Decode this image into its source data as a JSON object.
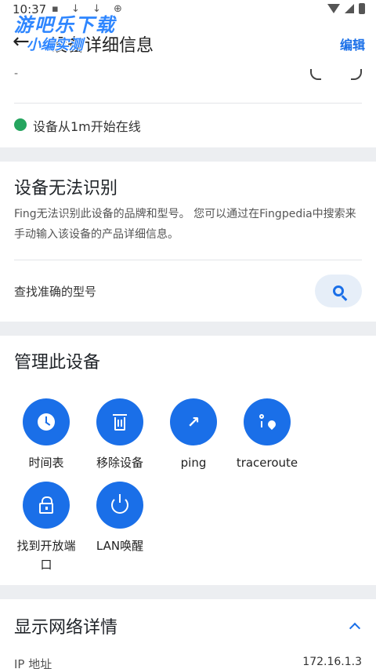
{
  "status_bar": {
    "time": "10:37",
    "left_icons": "▪ ↓ ↓ ⊕"
  },
  "watermark": {
    "line1": "游吧乐下载",
    "line2": "小编实测"
  },
  "app_bar": {
    "title": "设备详细信息",
    "edit_label": "编辑"
  },
  "device_card": {
    "dash": "-",
    "online_status": "设备从1m开始在线",
    "status_color": "#25a55f"
  },
  "unknown_card": {
    "title": "设备无法识别",
    "description": "Fing无法识别此设备的品牌和型号。 您可以通过在Fingpedia中搜索来手动输入该设备的产品详细信息。",
    "find_model_label": "查找准确的型号"
  },
  "manage_card": {
    "title": "管理此设备",
    "actions": [
      {
        "label": "时间表",
        "icon": "clock-icon"
      },
      {
        "label": "移除设备",
        "icon": "trash-icon"
      },
      {
        "label": "ping",
        "icon": "trending-up-icon"
      },
      {
        "label": "traceroute",
        "icon": "route-icon"
      },
      {
        "label": "找到开放端口",
        "icon": "lock-open-icon"
      },
      {
        "label": "LAN唤醒",
        "icon": "power-icon"
      }
    ]
  },
  "network_card": {
    "title": "显示网络详情",
    "ip_label": "IP 地址",
    "ip_value": "172.16.1.3"
  },
  "colors": {
    "accent": "#1a6fe8",
    "online": "#25a55f",
    "background": "#eceef1"
  }
}
